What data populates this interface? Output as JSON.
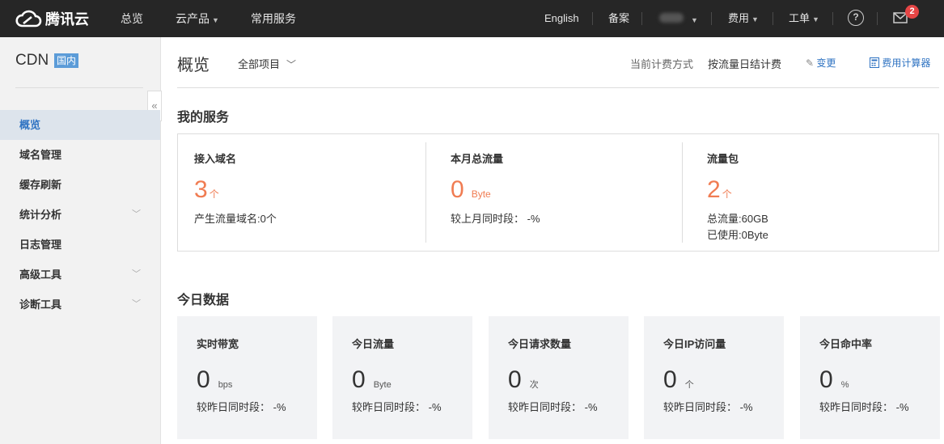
{
  "topbar": {
    "logo_text": "腾讯云",
    "nav": [
      "总览",
      "云产品",
      "常用服务"
    ],
    "right": {
      "language": "English",
      "beian": "备案",
      "fees": "费用",
      "tickets": "工单",
      "mail_badge": "2"
    }
  },
  "sidebar": {
    "title": "CDN",
    "tag": "国内",
    "items": [
      {
        "label": "概览",
        "active": true
      },
      {
        "label": "域名管理"
      },
      {
        "label": "缓存刷新"
      },
      {
        "label": "统计分析",
        "expandable": true
      },
      {
        "label": "日志管理"
      },
      {
        "label": "高级工具",
        "expandable": true
      },
      {
        "label": "诊断工具",
        "expandable": true
      }
    ]
  },
  "header": {
    "title": "概览",
    "project": "全部项目",
    "billing_label": "当前计费方式",
    "billing_value": "按流量日结计费",
    "change": "变更",
    "calculator": "费用计算器"
  },
  "services": {
    "title": "我的服务",
    "items": [
      {
        "label": "接入域名",
        "value": "3",
        "unit": "个",
        "lines": [
          "产生流量域名:0个"
        ]
      },
      {
        "label": "本月总流量",
        "value": "0",
        "unit": "Byte",
        "lines": [
          "较上月同时段： -%"
        ]
      },
      {
        "label": "流量包",
        "value": "2",
        "unit": "个",
        "lines": [
          "总流量:60GB",
          "已使用:0Byte"
        ]
      }
    ]
  },
  "today": {
    "title": "今日数据",
    "cards": [
      {
        "label": "实时带宽",
        "value": "0",
        "unit": "bps",
        "compare": "较昨日同时段： -%"
      },
      {
        "label": "今日流量",
        "value": "0",
        "unit": "Byte",
        "compare": "较昨日同时段： -%"
      },
      {
        "label": "今日请求数量",
        "value": "0",
        "unit": "次",
        "compare": "较昨日同时段： -%"
      },
      {
        "label": "今日IP访问量",
        "value": "0",
        "unit": "个",
        "compare": "较昨日同时段： -%"
      },
      {
        "label": "今日命中率",
        "value": "0",
        "unit": "%",
        "compare": "较昨日同时段： -%"
      }
    ]
  },
  "colors": {
    "topbar_bg": "#262626",
    "accent": "#2f73c2",
    "highlight_number": "#f07c52",
    "tag_bg": "#5c9cd8",
    "badge": "#e54545"
  }
}
